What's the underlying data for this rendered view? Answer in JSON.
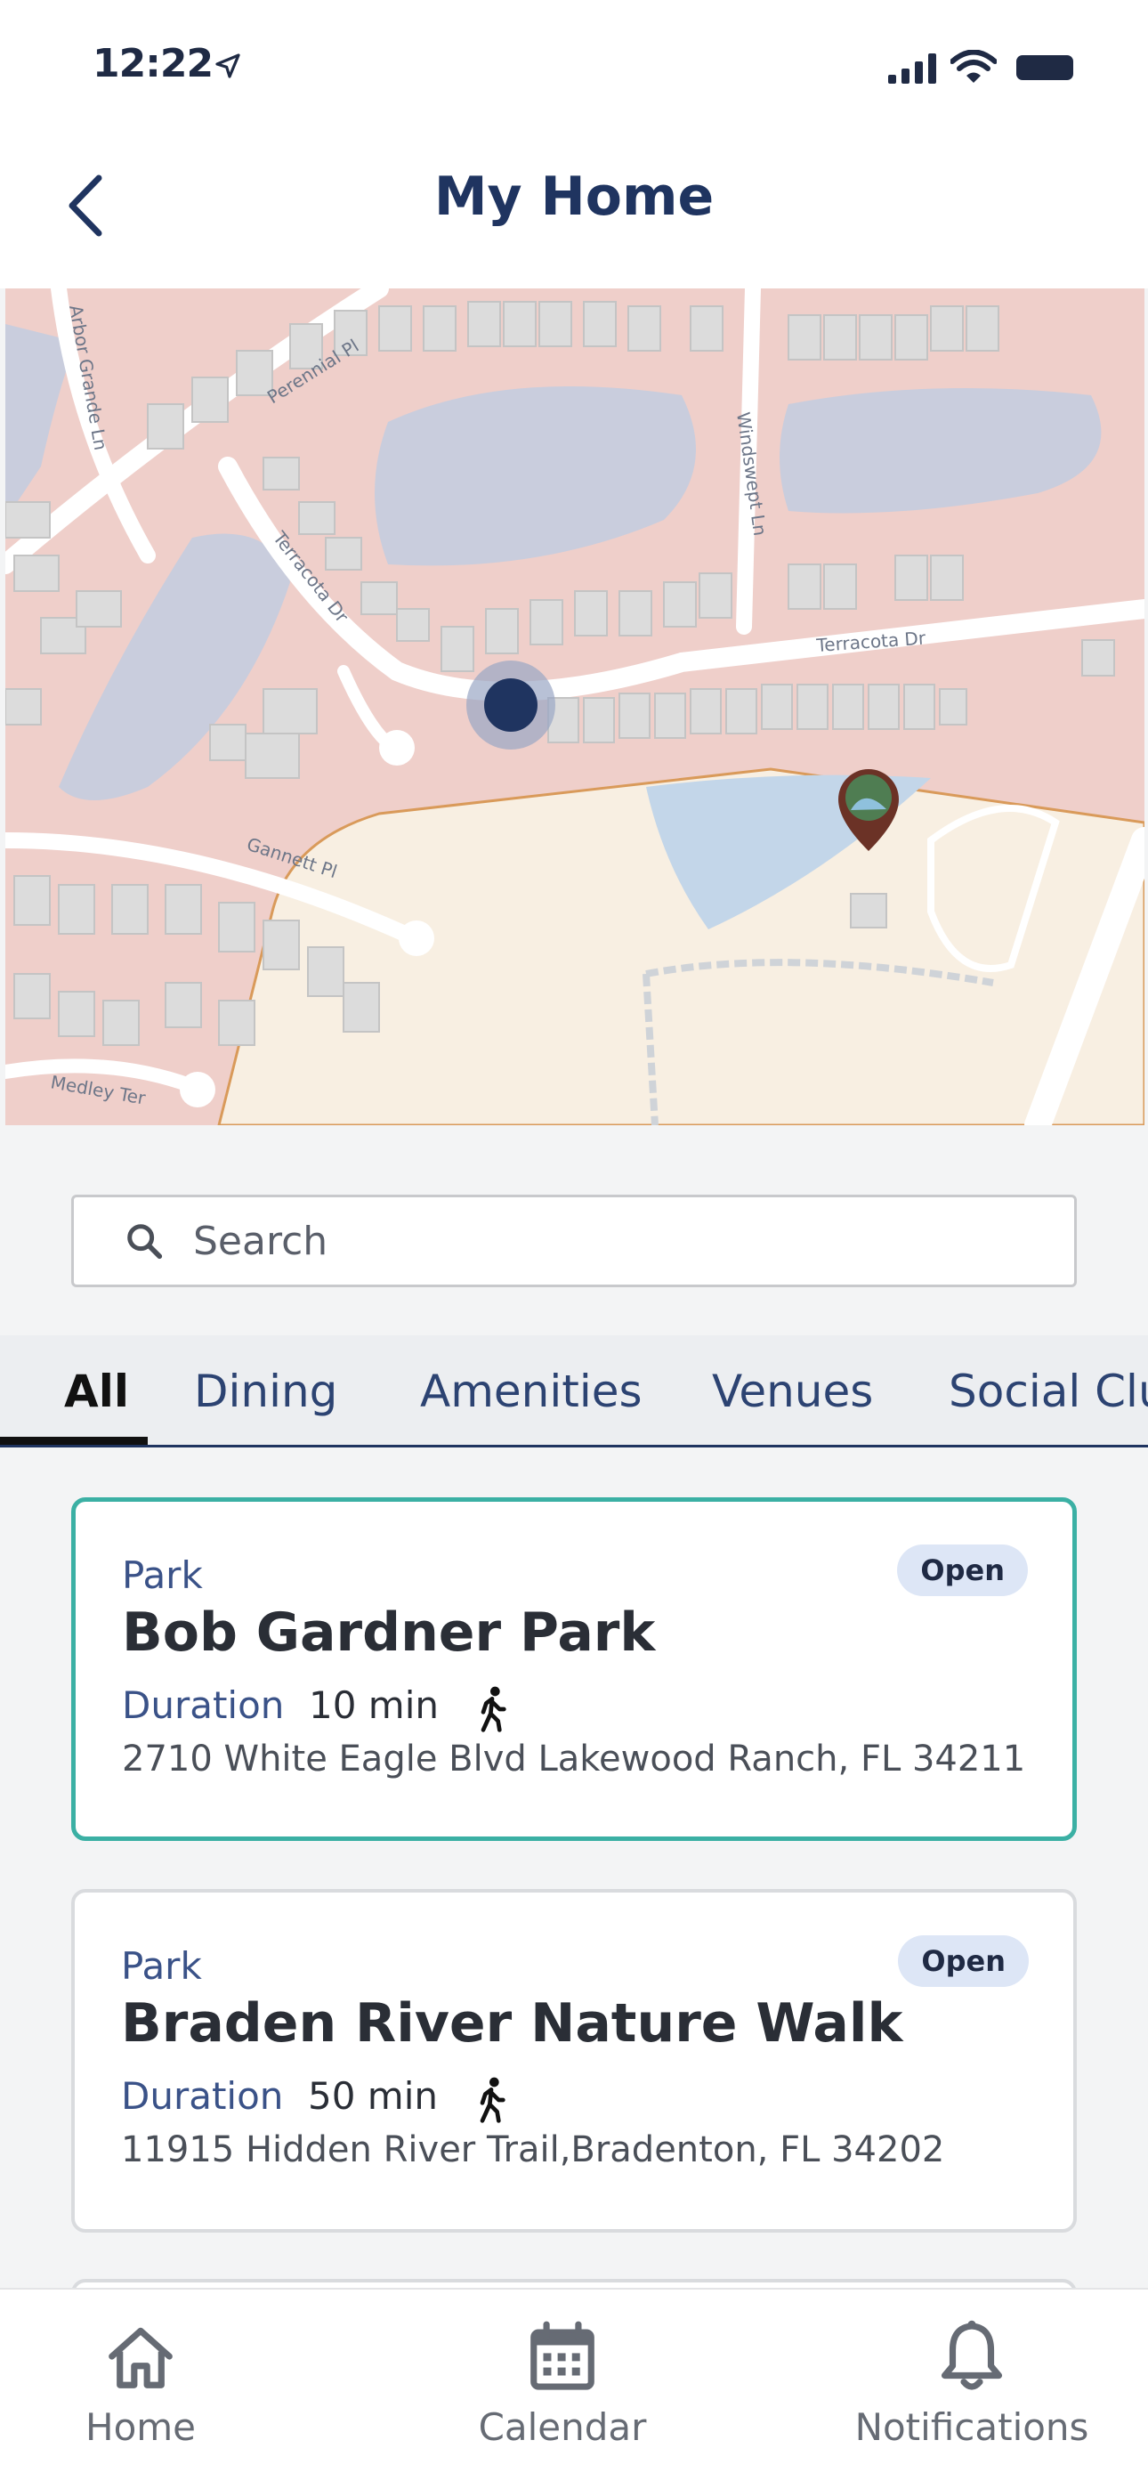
{
  "status_bar": {
    "time": "12:22"
  },
  "header": {
    "title": "My Home"
  },
  "map": {
    "streets": [
      "Arbor Grande Ln",
      "Perennial Pl",
      "Terracota Dr",
      "Windswept Ln",
      "Terracota Dr",
      "Gannett Pl",
      "Medley Ter"
    ]
  },
  "search": {
    "placeholder": "Search",
    "value": ""
  },
  "tabs": [
    {
      "label": "All",
      "active": true
    },
    {
      "label": "Dining",
      "active": false
    },
    {
      "label": "Amenities",
      "active": false
    },
    {
      "label": "Venues",
      "active": false
    },
    {
      "label": "Social Clu",
      "active": false
    }
  ],
  "cards": [
    {
      "category": "Park",
      "title": "Bob Gardner Park",
      "status": "Open",
      "duration_label": "Duration",
      "duration": "10 min",
      "address": "2710 White Eagle Blvd Lakewood Ranch, FL 34211",
      "selected": true
    },
    {
      "category": "Park",
      "title": "Braden River Nature Walk",
      "status": "Open",
      "duration_label": "Duration",
      "duration": "50 min",
      "address": "11915 Hidden River Trail,Bradenton, FL 34202",
      "selected": false
    }
  ],
  "nav": {
    "items": [
      {
        "label": "Home",
        "icon": "home-icon"
      },
      {
        "label": "Calendar",
        "icon": "calendar-icon"
      },
      {
        "label": "Notifications",
        "icon": "bell-icon"
      }
    ]
  },
  "colors": {
    "primary": "#1f3460",
    "selected_border": "#3bb0a4",
    "badge_bg": "#dde6f6",
    "map_residential": "#efcfca",
    "map_park": "#f8efe2",
    "map_water": "#c9cddd"
  }
}
